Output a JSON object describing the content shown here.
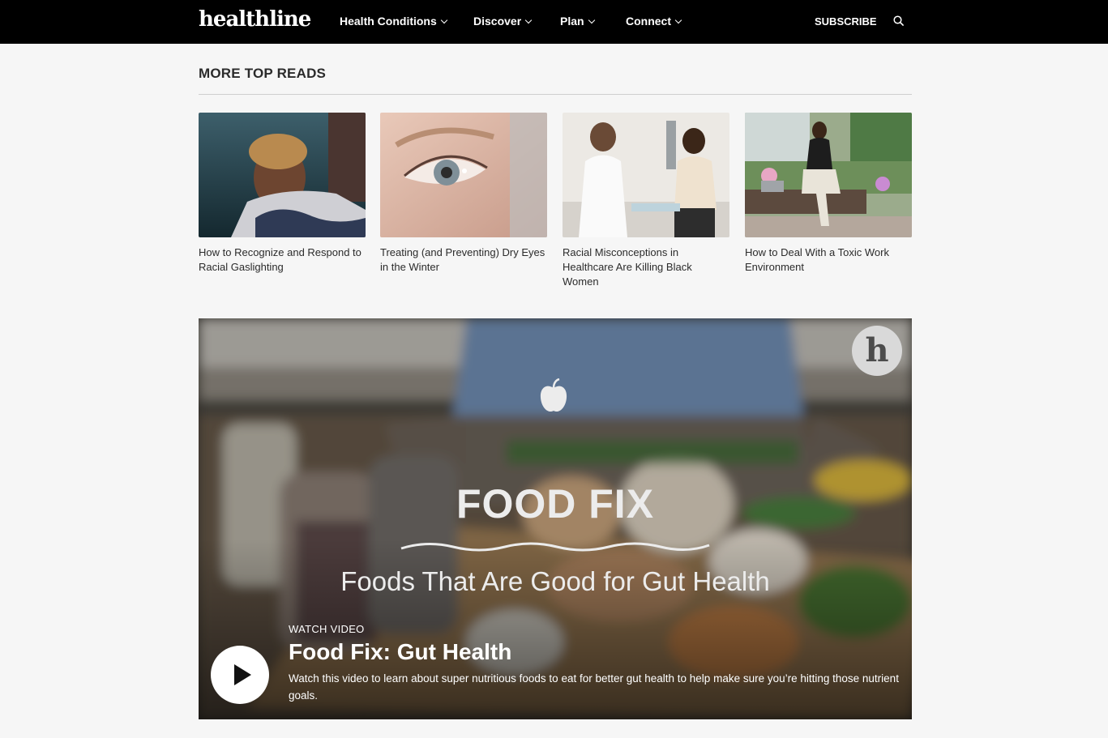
{
  "header": {
    "logo": "healthline",
    "nav": [
      {
        "label": "Health Conditions"
      },
      {
        "label": "Discover"
      },
      {
        "label": "Plan"
      },
      {
        "label": "Connect"
      }
    ],
    "subscribe": "SUBSCRIBE"
  },
  "top_reads": {
    "heading": "MORE TOP READS",
    "cards": [
      {
        "title": "How to Recognize and Respond to Racial Gaslighting"
      },
      {
        "title": "Treating (and Preventing) Dry Eyes in the Winter"
      },
      {
        "title": "Racial Misconceptions in Healthcare Are Killing Black Women"
      },
      {
        "title": "How to Deal With a Toxic Work Environment"
      }
    ]
  },
  "video": {
    "badge": "h",
    "overlay_title": "FOOD FIX",
    "overlay_subtitle": "Foods That Are Good for Gut Health",
    "label": "WATCH VIDEO",
    "title": "Food Fix: Gut Health",
    "description": "Watch this video to learn about super nutritious foods to eat for better gut health to help make sure you’re hitting those nutrient goals."
  },
  "colors": {
    "header_bg": "#000000",
    "page_bg": "#f6f6f6",
    "text": "#2b2b2b"
  }
}
